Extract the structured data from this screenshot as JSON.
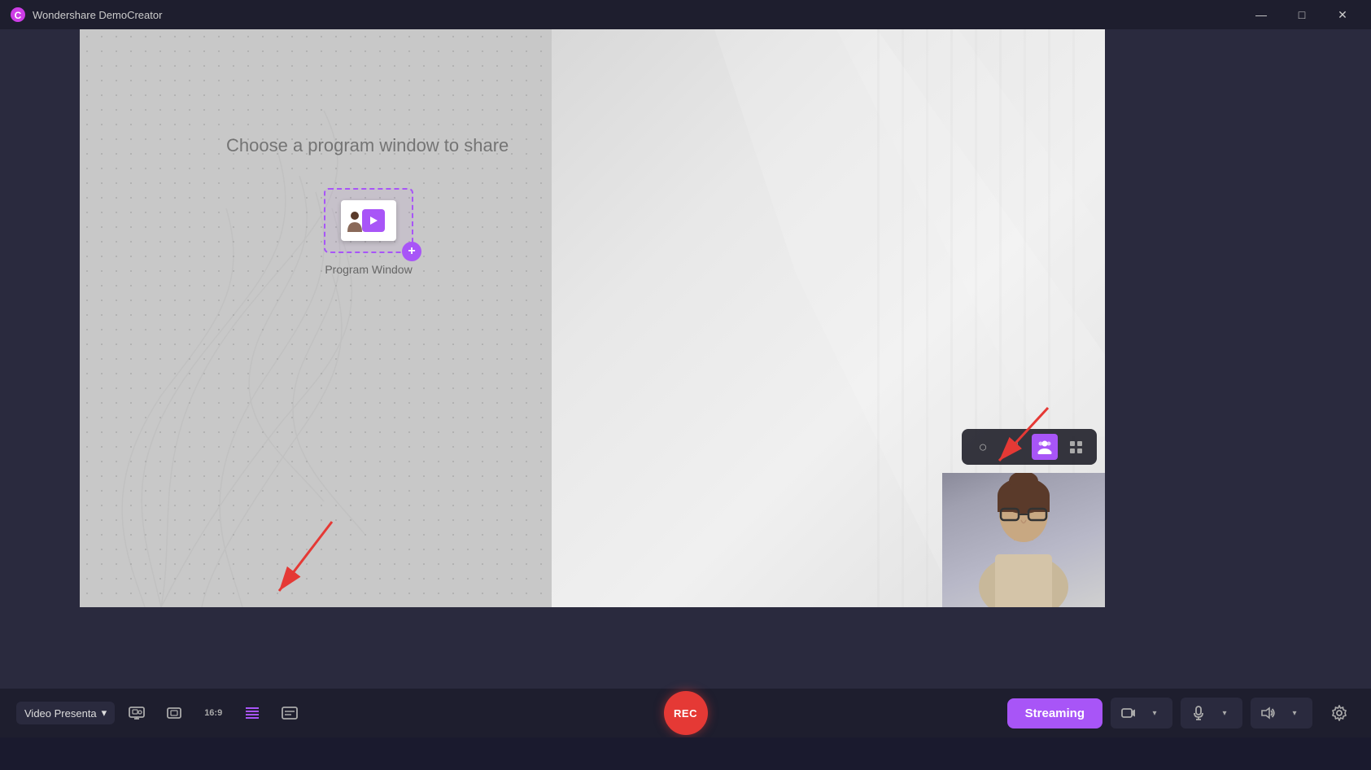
{
  "titleBar": {
    "appName": "Wondershare DemoCreator",
    "logoColor": "#e040fb",
    "controls": {
      "minimize": "—",
      "maximize": "□",
      "close": "✕"
    }
  },
  "canvas": {
    "chooseText": "Choose a program window to share",
    "programWindowLabel": "Program Window"
  },
  "webcamControls": {
    "buttons": [
      {
        "id": "circle",
        "icon": "○",
        "active": false
      },
      {
        "id": "square",
        "icon": "□",
        "active": false
      },
      {
        "id": "people",
        "icon": "👤",
        "active": true
      },
      {
        "id": "grid",
        "icon": "⊞",
        "active": false
      }
    ]
  },
  "bottomToolbar": {
    "dropdown": {
      "label": "Video Presenta",
      "chevron": "▾"
    },
    "iconButtons": [
      {
        "id": "screen",
        "icon": "🖥",
        "label": "screen"
      },
      {
        "id": "overlay",
        "icon": "⬚",
        "label": "overlay"
      },
      {
        "id": "ratio",
        "icon": "16:9",
        "label": "ratio"
      },
      {
        "id": "stripe",
        "icon": "▦",
        "label": "stripe",
        "active": true
      },
      {
        "id": "caption",
        "icon": "▤",
        "label": "caption"
      }
    ],
    "recButton": "REC",
    "streamingButton": "Streaming",
    "rightGroups": [
      {
        "id": "camera-group",
        "buttons": [
          {
            "id": "camera-icon",
            "icon": "📷"
          },
          {
            "id": "camera-chevron",
            "icon": "▾"
          }
        ]
      },
      {
        "id": "mic-group",
        "buttons": [
          {
            "id": "mic-icon",
            "icon": "🎤"
          },
          {
            "id": "mic-chevron",
            "icon": "▾"
          }
        ]
      },
      {
        "id": "speaker-group",
        "buttons": [
          {
            "id": "speaker-icon",
            "icon": "🔊"
          },
          {
            "id": "speaker-chevron",
            "icon": "▾"
          }
        ]
      }
    ],
    "gearIcon": "⚙"
  }
}
